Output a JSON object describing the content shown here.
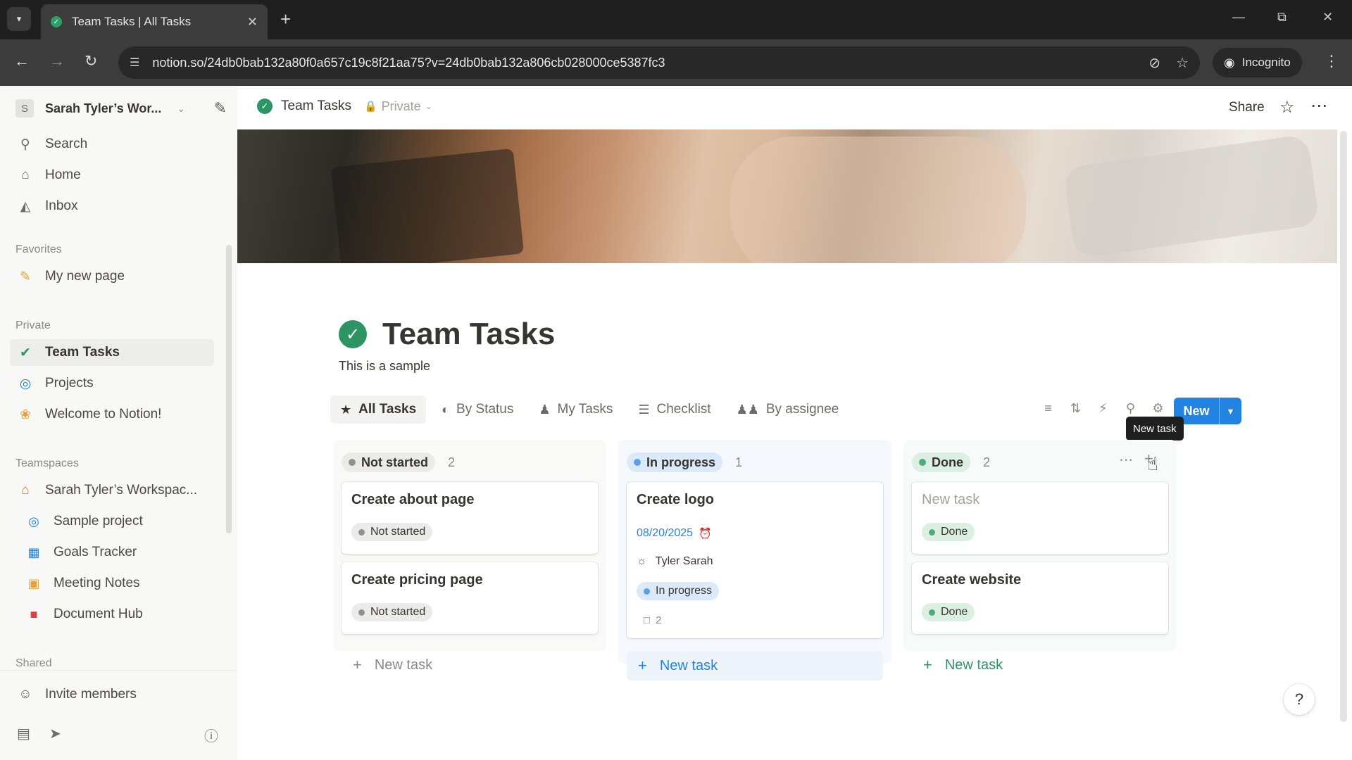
{
  "browser": {
    "tab_title": "Team Tasks | All Tasks",
    "url": "notion.so/24db0bab132a80f0a657c19c8f21aa75?v=24db0bab132a806cb028000ce5387fc3",
    "incognito_label": "Incognito"
  },
  "sidebar": {
    "workspace_initial": "S",
    "workspace_name": "Sarah Tyler’s Wor...",
    "top_items": [
      {
        "label": "Search",
        "icon": "search-icon"
      },
      {
        "label": "Home",
        "icon": "home-icon"
      },
      {
        "label": "Inbox",
        "icon": "inbox-icon"
      }
    ],
    "sections": {
      "favorites": "Favorites",
      "private": "Private",
      "teamspaces": "Teamspaces",
      "shared": "Shared"
    },
    "favorites": [
      {
        "label": "My new page",
        "icon": "pencil-icon"
      }
    ],
    "private_items": [
      {
        "label": "Team Tasks",
        "icon": "check-circle-icon"
      },
      {
        "label": "Projects",
        "icon": "target-icon"
      },
      {
        "label": "Welcome to Notion!",
        "icon": "wave-icon"
      }
    ],
    "teamspace_name": "Sarah Tyler’s Workspac...",
    "teamspace_items": [
      {
        "label": "Sample project",
        "icon": "target-icon"
      },
      {
        "label": "Goals Tracker",
        "icon": "chart-icon"
      },
      {
        "label": "Meeting Notes",
        "icon": "calendar-icon"
      },
      {
        "label": "Document Hub",
        "icon": "bookmark-icon"
      }
    ],
    "invite_label": "Invite members"
  },
  "topbar": {
    "breadcrumb_title": "Team Tasks",
    "privacy_label": "Private",
    "share_label": "Share"
  },
  "page": {
    "title": "Team Tasks",
    "description": "This is a sample"
  },
  "views": [
    {
      "label": "All Tasks",
      "icon": "star-icon"
    },
    {
      "label": "By Status",
      "icon": "status-icon"
    },
    {
      "label": "My Tasks",
      "icon": "person-icon"
    },
    {
      "label": "Checklist",
      "icon": "checklist-icon"
    },
    {
      "label": "By assignee",
      "icon": "people-icon"
    }
  ],
  "new_button_label": "New",
  "tooltip": "New task",
  "colors": {
    "accent": "#2383e2",
    "not_started": "#91918e",
    "in_progress": "#5e9fe8",
    "done": "#4dab7f"
  },
  "columns": [
    {
      "status": "Not started",
      "count": "2",
      "cards": [
        {
          "title": "Create about page",
          "status": "Not started"
        },
        {
          "title": "Create pricing page",
          "status": "Not started"
        }
      ],
      "add_label": "New task"
    },
    {
      "status": "In progress",
      "count": "1",
      "cards": [
        {
          "title": "Create logo",
          "date": "08/20/2025",
          "assignee": "Tyler Sarah",
          "status": "In progress",
          "comments": "2"
        }
      ],
      "add_label": "New task"
    },
    {
      "status": "Done",
      "count": "2",
      "cards": [
        {
          "title": "New task",
          "status": "Done"
        },
        {
          "title": "Create website",
          "status": "Done"
        }
      ],
      "add_label": "New task"
    }
  ]
}
